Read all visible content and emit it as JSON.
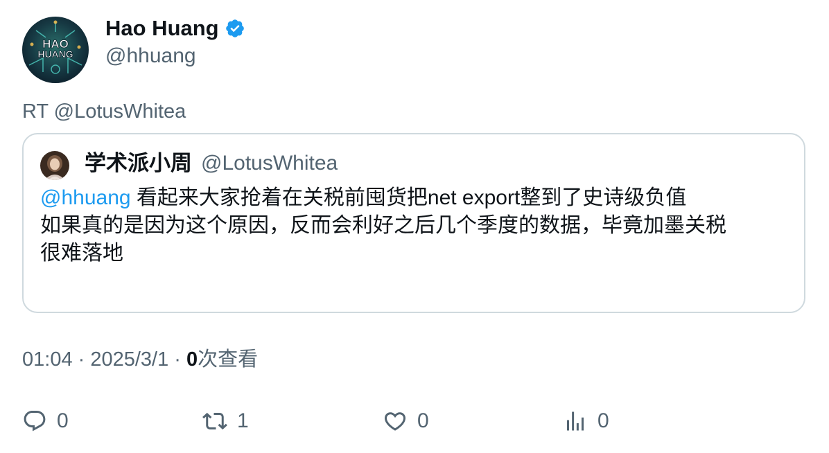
{
  "author": {
    "display_name": "Hao Huang",
    "handle": "@hhuang",
    "avatar_text_top": "HAO",
    "avatar_text_bottom": "HUANG"
  },
  "retweet_line": "RT @LotusWhitea",
  "quoted": {
    "display_name": "学术派小周",
    "handle": "@LotusWhitea",
    "mention": "@hhuang",
    "line1_text": " 看起来大家抢着在关税前囤货把net export整到了史诗级负值",
    "line2": "如果真的是因为这个原因，反而会利好之后几个季度的数据，毕竟加墨关税",
    "line3": "很难落地"
  },
  "meta": {
    "time": "01:04",
    "separator": " · ",
    "date": "2025/3/1",
    "views_count": "0",
    "views_label": "次查看"
  },
  "actions": {
    "reply_count": "0",
    "retweet_count": "1",
    "like_count": "0",
    "views_count": "0"
  },
  "colors": {
    "verified": "#1d9bf0",
    "mention": "#1d9bf0",
    "secondary_text": "#536471",
    "border": "#cfd9de"
  }
}
